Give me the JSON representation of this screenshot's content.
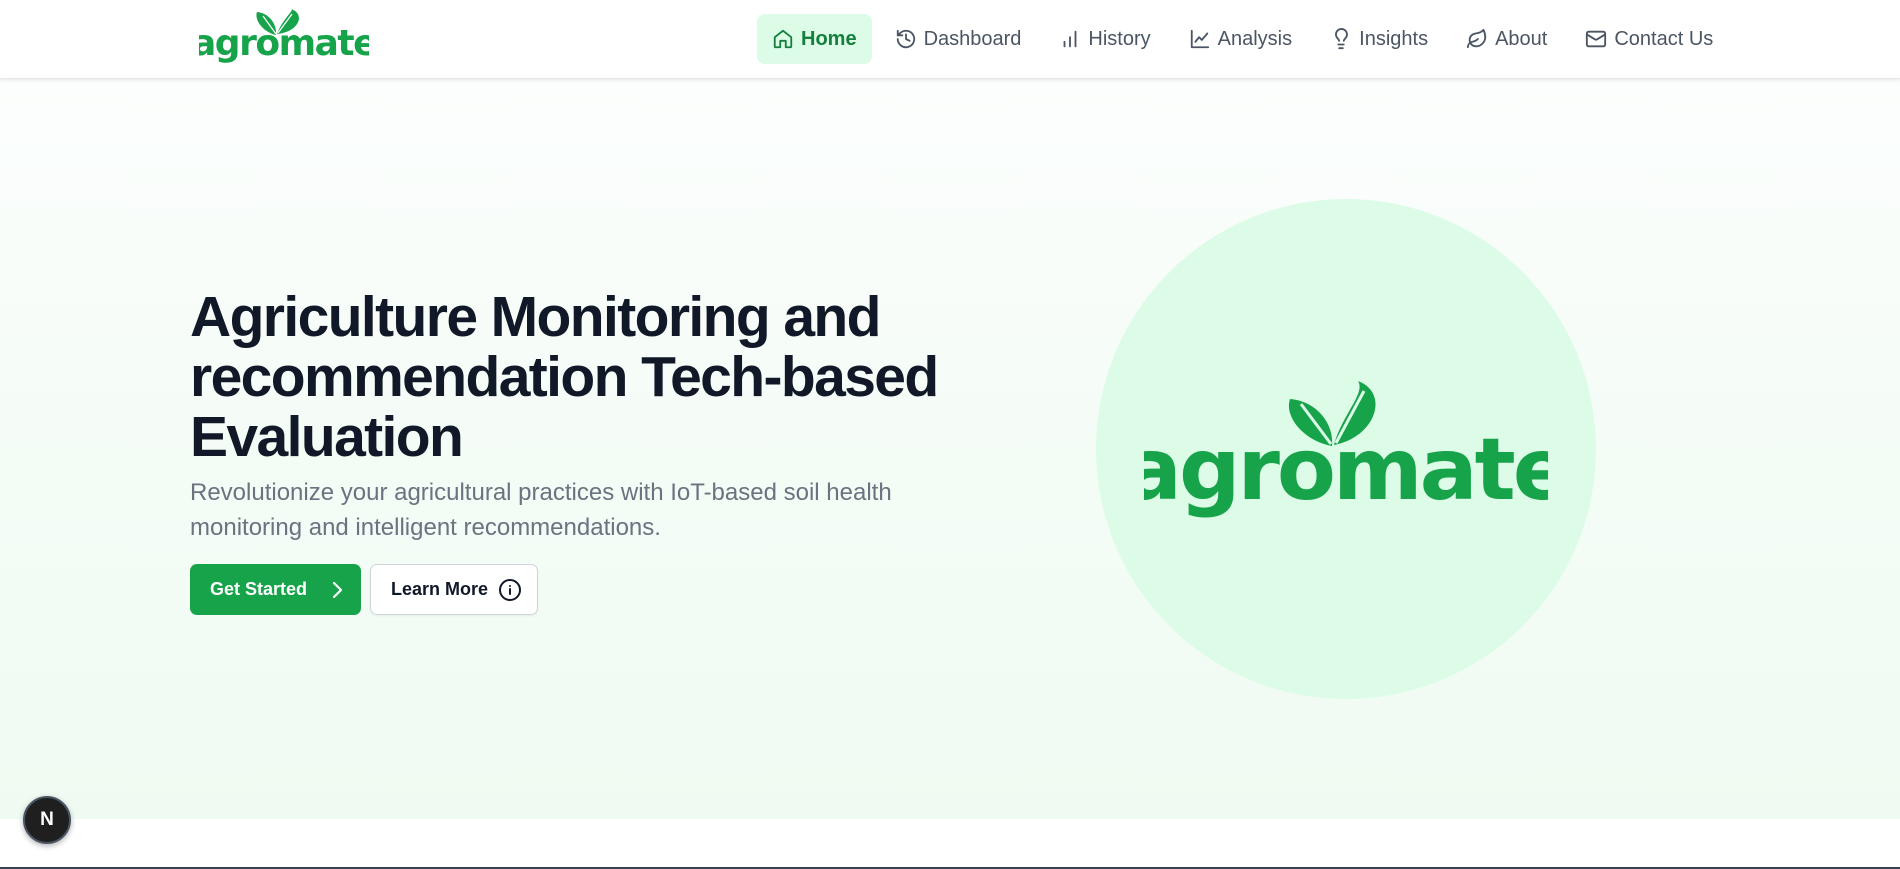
{
  "brand": {
    "logo_text": "agromate",
    "logo_color": "#16a34a"
  },
  "nav": {
    "items": [
      {
        "label": "Home",
        "icon": "home-icon",
        "active": true
      },
      {
        "label": "Dashboard",
        "icon": "history-icon",
        "active": false
      },
      {
        "label": "History",
        "icon": "bar-chart-icon",
        "active": false
      },
      {
        "label": "Analysis",
        "icon": "line-chart-icon",
        "active": false
      },
      {
        "label": "Insights",
        "icon": "lightbulb-icon",
        "active": false
      },
      {
        "label": "About",
        "icon": "leaf-icon",
        "active": false
      },
      {
        "label": "Contact Us",
        "icon": "mail-icon",
        "active": false
      }
    ]
  },
  "hero": {
    "title": "Agriculture Monitoring and recommendation Tech-based Evaluation",
    "subtitle": "Revolutionize your agricultural practices with IoT-based soil health monitoring and intelligent recommendations.",
    "primary_button": "Get Started",
    "secondary_button": "Learn More"
  },
  "dev_badge": {
    "label": "N"
  },
  "colors": {
    "accent": "#16a34a",
    "accent_light": "#dcfce7",
    "active_text": "#15803d",
    "heading": "#111827",
    "muted": "#6b7280"
  }
}
